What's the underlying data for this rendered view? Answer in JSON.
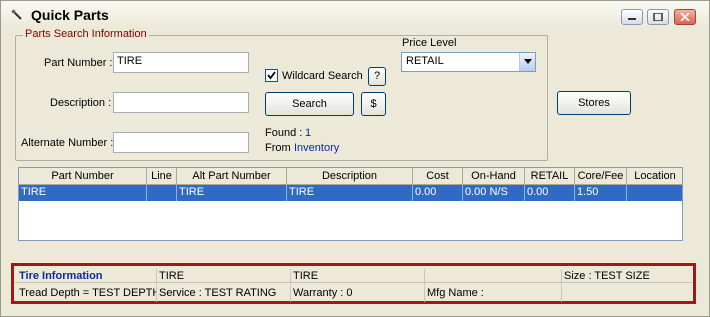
{
  "window": {
    "title": "Quick Parts"
  },
  "search": {
    "group_title": "Parts Search Information",
    "part_number_label": "Part Number :",
    "part_number_value": "TIRE",
    "description_label": "Description :",
    "description_value": "",
    "alternate_number_label": "Alternate Number :",
    "alternate_number_value": "",
    "wildcard_label": "Wildcard Search",
    "wildcard_checked": true,
    "help_button": "?",
    "search_button": "Search",
    "dollar_button": "$",
    "found_label": "Found :",
    "found_value": "1",
    "from_label": "From",
    "from_value": "Inventory",
    "price_level_label": "Price Level",
    "price_level_value": "RETAIL"
  },
  "stores_button": "Stores",
  "grid": {
    "columns": [
      "Part Number",
      "Line",
      "Alt Part Number",
      "Description",
      "Cost",
      "On-Hand",
      "RETAIL",
      "Core/Fee",
      "Location"
    ],
    "rows": [
      [
        "TIRE",
        "",
        "TIRE",
        "TIRE",
        "0.00",
        "0.00 N/S",
        "0.00",
        "1.50",
        ""
      ]
    ]
  },
  "info": {
    "title": "Tire Information",
    "col2": "TIRE",
    "col3": "TIRE",
    "col4": "",
    "size": "Size : TEST SIZE",
    "tread": "Tread Depth = TEST DEPTH",
    "service": "Service : TEST RATING",
    "warranty": "Warranty : 0",
    "mfg": "Mfg Name :",
    "extra": ""
  },
  "colors": {
    "accent": "#316ac5",
    "info_border": "#a01818",
    "label_red": "#800000",
    "link_blue": "#0b2a9e"
  }
}
